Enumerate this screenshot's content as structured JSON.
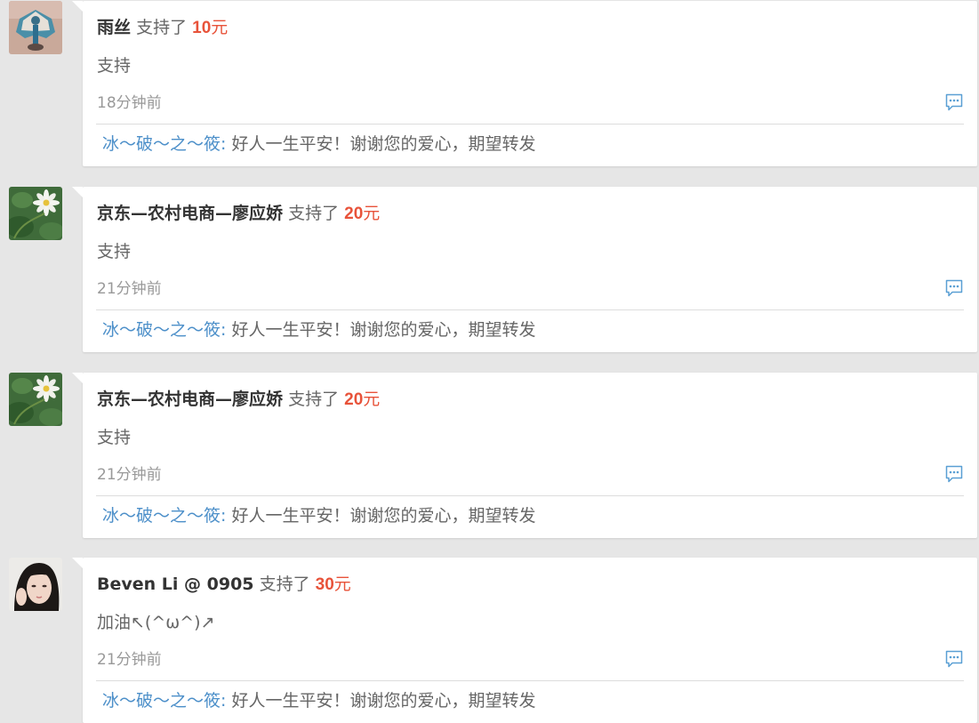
{
  "supports": [
    {
      "username": "雨丝",
      "action": "支持了",
      "amount": "10",
      "unit": "元",
      "message": "支持",
      "time_num": "18",
      "time_unit": "分钟前",
      "reply_author": "冰～破～之～筱:",
      "reply_text": "好人一生平安！谢谢您的爱心，期望转发",
      "avatar_icon": "peacock-figurine-avatar"
    },
    {
      "username": "京东—农村电商—廖应娇",
      "action": "支持了",
      "amount": "20",
      "unit": "元",
      "message": "支持",
      "time_num": "21",
      "time_unit": "分钟前",
      "reply_author": "冰～破～之～筱:",
      "reply_text": "好人一生平安！谢谢您的爱心，期望转发",
      "avatar_icon": "white-flower-avatar"
    },
    {
      "username": "京东—农村电商—廖应娇",
      "action": "支持了",
      "amount": "20",
      "unit": "元",
      "message": "支持",
      "time_num": "21",
      "time_unit": "分钟前",
      "reply_author": "冰～破～之～筱:",
      "reply_text": "好人一生平安！谢谢您的爱心，期望转发",
      "avatar_icon": "white-flower-avatar"
    },
    {
      "username": "Beven Li @ 0905",
      "action": "支持了",
      "amount": "30",
      "unit": "元",
      "message": "加油↖(^ω^)↗",
      "time_num": "21",
      "time_unit": "分钟前",
      "reply_author": "冰～破～之～筱:",
      "reply_text": "好人一生平安！谢谢您的爱心，期望转发",
      "avatar_icon": "portrait-avatar"
    }
  ],
  "colors": {
    "background": "#e6e6e6",
    "amount": "#e8533a",
    "reply_author": "#4c8fc9",
    "comment_icon": "#5a9fd4"
  },
  "icons": {
    "comment": "comment-bubble-icon"
  }
}
